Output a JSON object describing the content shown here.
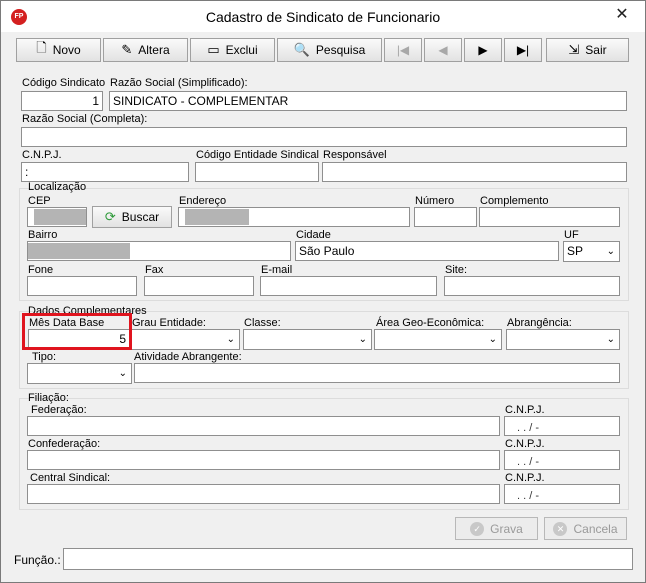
{
  "window": {
    "title": "Cadastro de Sindicato de Funcionario",
    "app_icon_text": "FP",
    "close_symbol": "✕"
  },
  "toolbar": {
    "novo": "Novo",
    "altera": "Altera",
    "exclui": "Exclui",
    "pesquisa": "Pesquisa",
    "sair": "Sair",
    "first": "|◀",
    "prev": "◀",
    "next": "▶",
    "last": "▶|"
  },
  "header": {
    "codigo_label": "Código Sindicato",
    "codigo_value": "1",
    "razao_simpl_label": "Razão Social (Simplificado):",
    "razao_simpl_value": "SINDICATO - COMPLEMENTAR",
    "razao_comp_label": "Razão Social (Completa):",
    "razao_comp_value": "",
    "cnpj_label": "C.N.P.J.",
    "cnpj_value": ":",
    "codigo_entidade_label": "Código Entidade Sindical",
    "responsavel_label": "Responsável"
  },
  "localizacao": {
    "group_label": "Localização",
    "cep_label": "CEP",
    "buscar_label": "Buscar",
    "endereco_label": "Endereço",
    "numero_label": "Número",
    "complemento_label": "Complemento",
    "bairro_label": "Bairro",
    "cidade_label": "Cidade",
    "cidade_value": "São Paulo",
    "uf_label": "UF",
    "uf_value": "SP",
    "fone_label": "Fone",
    "fax_label": "Fax",
    "email_label": "E-mail",
    "site_label": "Site:"
  },
  "dados": {
    "group_label": "Dados Complementares",
    "mes_label": "Mês Data Base",
    "mes_value": "5",
    "grau_label": "Grau Entidade:",
    "classe_label": "Classe:",
    "area_label": "Área Geo-Econômica:",
    "abrangencia_label": "Abrangência:",
    "tipo_label": "Tipo:",
    "atividade_label": "Atividade Abrangente:"
  },
  "filiacao": {
    "group_label": "Filiação:",
    "federacao_label": "Federação:",
    "confederacao_label": "Confederação:",
    "central_label": "Central Sindical:",
    "cnpj_label": "C.N.P.J.",
    "cnpj_mask": ".   .   /   -"
  },
  "footer": {
    "grava": "Grava",
    "cancela": "Cancela",
    "funcao_label": "Função.:"
  }
}
